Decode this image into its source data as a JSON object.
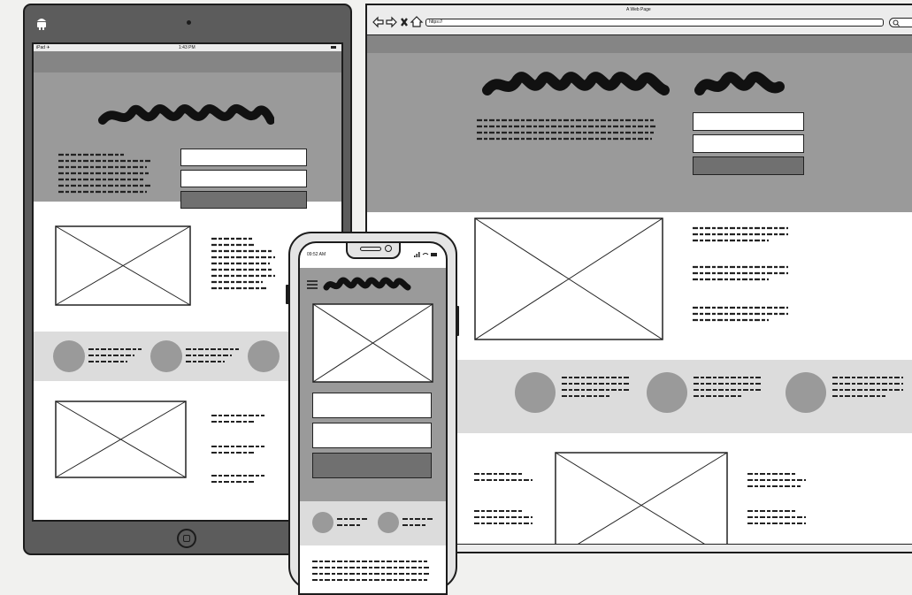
{
  "tablet": {
    "status_left": "iPad ✈",
    "status_time": "1:43 PM"
  },
  "browser": {
    "title": "A Web Page",
    "url": "https://"
  },
  "phone": {
    "status_time": "09:52 AM"
  },
  "icons": {
    "back": "back-arrow-icon",
    "forward": "forward-arrow-icon",
    "stop": "close-icon",
    "home": "home-icon",
    "search": "search-icon",
    "menu": "hamburger-menu-icon",
    "logo": "android-logo-icon"
  },
  "colors": {
    "device_dark": "#5c5c5c",
    "header_grey": "#9a9a9a",
    "band_light": "#dcdcdc",
    "button_grey": "#707070"
  }
}
